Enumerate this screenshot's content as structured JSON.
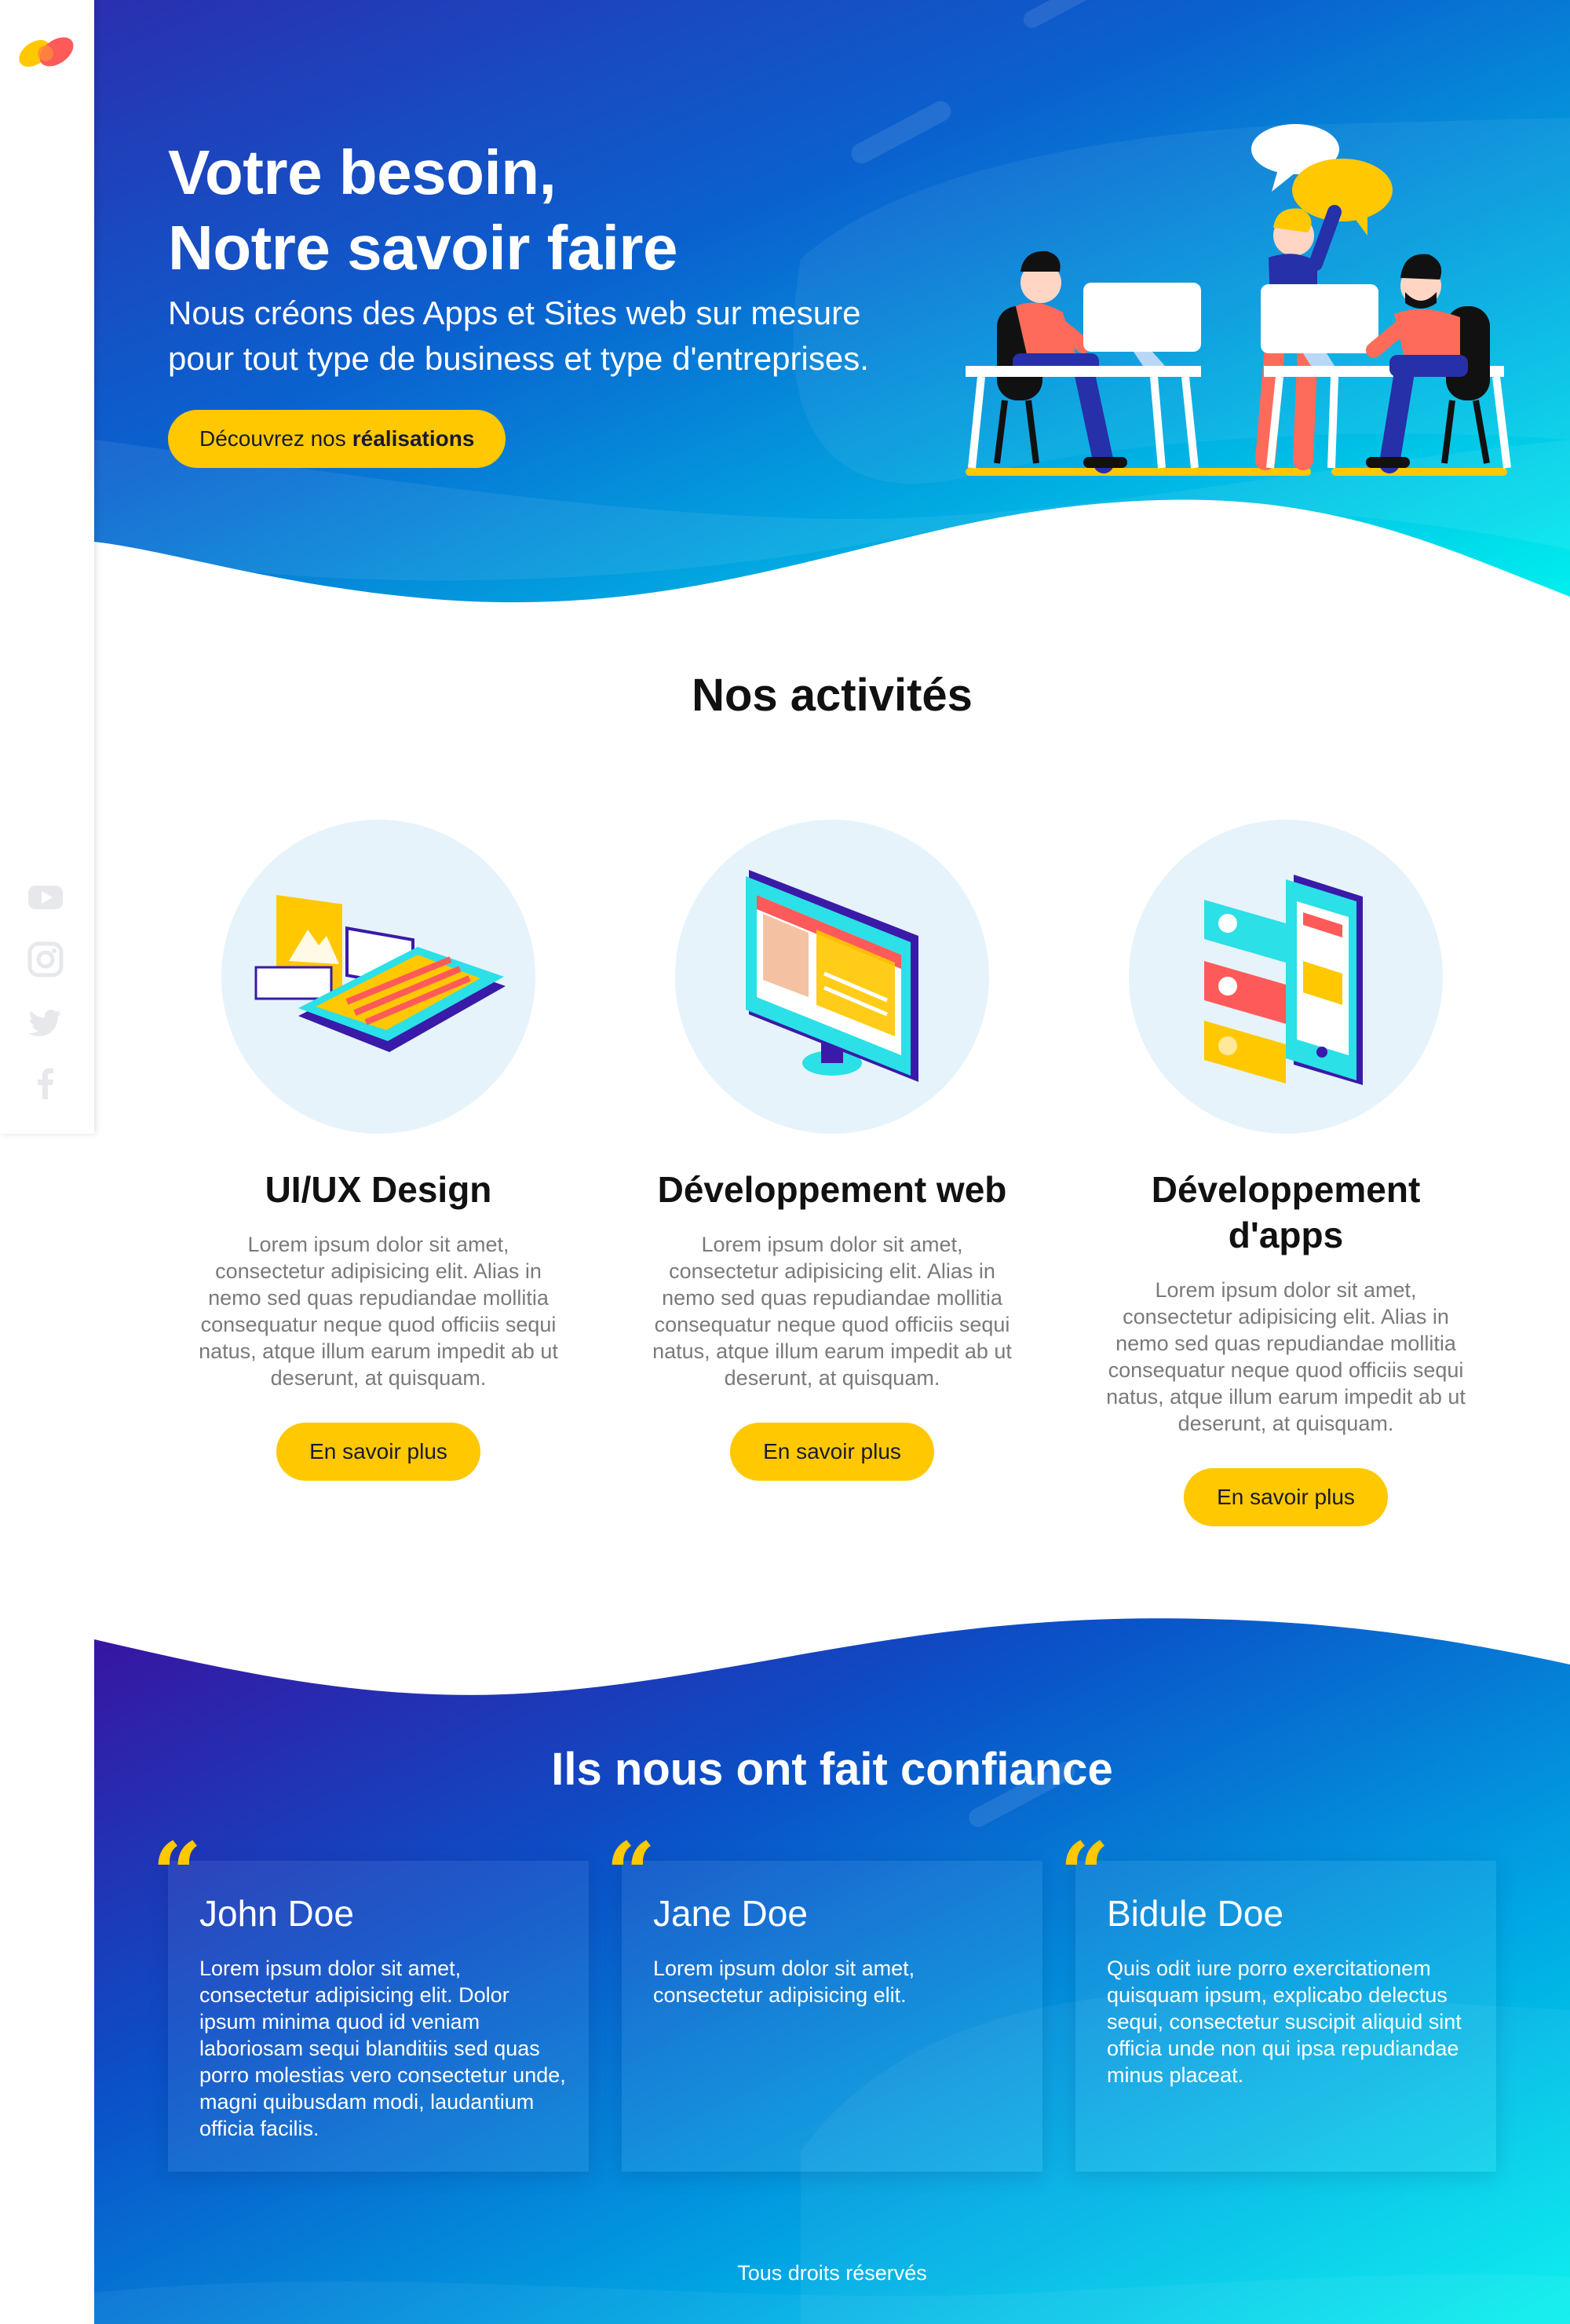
{
  "hero": {
    "title_line1": "Votre besoin,",
    "title_line2": "Notre savoir faire",
    "subtitle_line1": "Nous créons des Apps et Sites web sur mesure",
    "subtitle_line2": "pour tout type de business et type d'entreprises.",
    "cta_prefix": "Découvrez nos",
    "cta_bold": "réalisations"
  },
  "sidebar": {
    "social": [
      "youtube-icon",
      "instagram-icon",
      "twitter-icon",
      "facebook-icon"
    ]
  },
  "activities": {
    "title": "Nos activités",
    "items": [
      {
        "title": "UI/UX Design",
        "text": "Lorem ipsum dolor sit amet, consectetur adipisicing elit. Alias in nemo sed quas repudiandae mollitia consequatur neque quod officiis sequi natus, atque illum earum impedit ab ut deserunt, at quisquam.",
        "button": "En savoir plus"
      },
      {
        "title": "Développement web",
        "text": "Lorem ipsum dolor sit amet, consectetur adipisicing elit. Alias in nemo sed quas repudiandae mollitia consequatur neque quod officiis sequi natus, atque illum earum impedit ab ut deserunt, at quisquam.",
        "button": "En savoir plus"
      },
      {
        "title": "Développement d'apps",
        "text": "Lorem ipsum dolor sit amet, consectetur adipisicing elit. Alias in nemo sed quas repudiandae mollitia consequatur neque quod officiis sequi natus, atque illum earum impedit ab ut deserunt, at quisquam.",
        "button": "En savoir plus"
      }
    ]
  },
  "testimonials": {
    "title": "Ils nous ont fait confiance",
    "quote_mark": "“",
    "items": [
      {
        "name": "John Doe",
        "text": "Lorem ipsum dolor sit amet, consectetur adipisicing elit. Dolor ipsum minima quod id veniam laboriosam sequi blanditiis sed quas porro molestias vero consectetur unde, magni quibusdam modi, laudantium officia facilis."
      },
      {
        "name": "Jane Doe",
        "text": "Lorem ipsum dolor sit amet, consectetur adipisicing elit."
      },
      {
        "name": "Bidule Doe",
        "text": "Quis odit iure porro exercitationem quisquam ipsum, explicabo delectus sequi, consectetur suscipit aliquid sint officia unde non qui ipsa repudiandae minus placeat."
      }
    ]
  },
  "footer": {
    "text": "Tous droits réservés"
  },
  "colors": {
    "accent": "#ffc800",
    "gradient_start": "#3a1aa8",
    "gradient_mid": "#0a6fd6",
    "gradient_end": "#00e8ec",
    "text_muted": "#7a7a7a"
  }
}
